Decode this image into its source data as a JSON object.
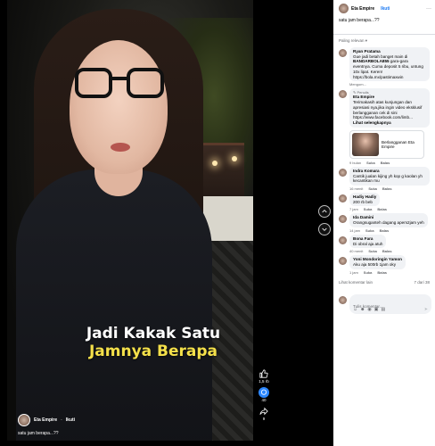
{
  "video": {
    "caption_line1": "Jadi Kakak Satu",
    "caption_line2": "Jamnya Berapa",
    "author_name": "Eta Empire",
    "follow_label": "Ikuti",
    "description": "satu jam berapa...??"
  },
  "actions": {
    "like_count": "1,5 rb",
    "comment_count": "40",
    "share_count": "9"
  },
  "panel": {
    "author_name": "Eta Empire",
    "follow_label": "Ikuti",
    "post_text": "satu jam berapa...??",
    "sort_label": "Paling relevan",
    "comments": [
      {
        "author": "Ryan Pratama",
        "text_pre": "Gue jadi betah banget main di ",
        "text_bold": "BANDARBOLA855",
        "text_post": " gara-gara eventnya. Cuma deposit 5 ribu, untung 10x lipat. Keren! https://bola.mx/pastimaxwin",
        "more": "Mengom..."
      },
      {
        "tag": "Penulis",
        "author": "Eta Empire",
        "text": "Terimakasih atas kunjungan dan apresiasi nya,jika ingin video eksklusif berlangganan cek di sini https://www.facebook.com/limb...",
        "see_link": "Lihat selengkapnya",
        "card_text": "Berlangganan Eta Empire",
        "time": "9 bulan",
        "like": "Suka",
        "reply": "Balas"
      },
      {
        "author": "Indra Komara",
        "text": "Cantik jualan kijing yh kop g kaolan yh kecantikan mu",
        "time": "16 menit",
        "like": "Suka",
        "reply": "Balas"
      },
      {
        "author": "Hadiy Hadiy",
        "text": "200 rb beb",
        "time": "7 jam",
        "like": "Suka",
        "reply": "Balas"
      },
      {
        "author": "Ida Damini",
        "text": "Orangsuganteh dagang apem2jam yeh",
        "time": "14 jam",
        "like": "Suka",
        "reply": "Balas"
      },
      {
        "author": "Bona Fara",
        "text": "Di obral aja atuh",
        "time": "40 menit",
        "like": "Suka",
        "reply": "Balas"
      },
      {
        "author": "Yoni Mondoringin Yamon",
        "text": "Aku aja 500rb 1jam oky",
        "time": "1 jam",
        "like": "Suka",
        "reply": "Balas"
      }
    ],
    "view_more": "Lihat komentar lain",
    "count_label": "7 dari 38",
    "write_placeholder": "Tulis komentar..."
  }
}
